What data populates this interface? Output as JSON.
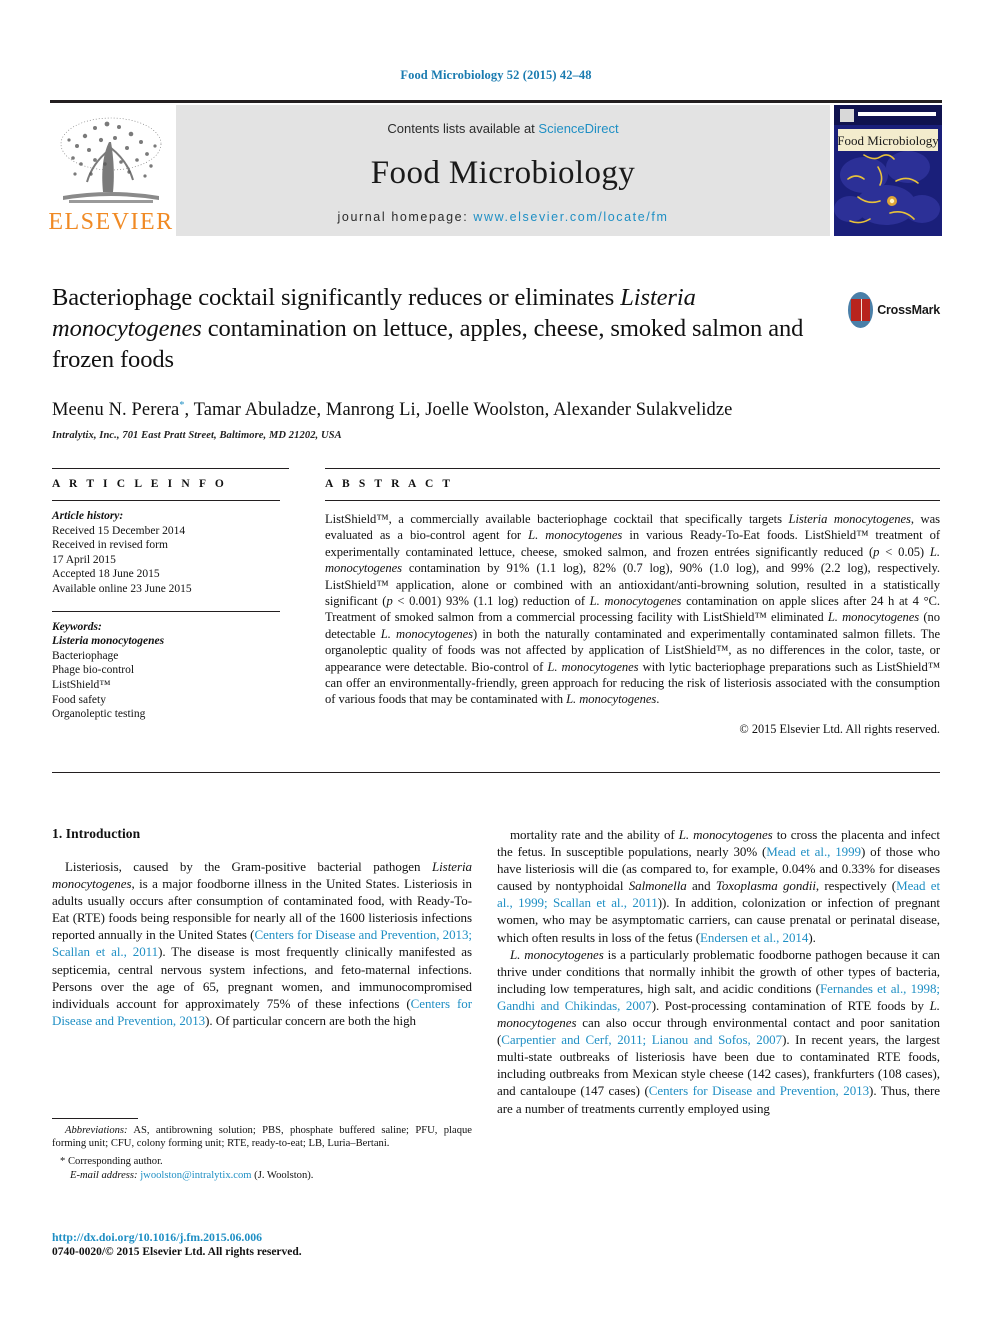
{
  "running_head": "Food Microbiology 52 (2015) 42–48",
  "masthead": {
    "contents_prefix": "Contents lists available at ",
    "sciencedirect": "ScienceDirect",
    "journal_name": "Food Microbiology",
    "homepage_prefix": "journal homepage: ",
    "homepage_url": "www.elsevier.com/locate/fm",
    "publisher_logo_text": "ELSEVIER",
    "cover_title": "Food Microbiology",
    "accent_link_color": "#1f8fc4",
    "elsevier_orange": "#f08a24",
    "panel_gray": "#e3e3e3"
  },
  "crossmark": {
    "label": "CrossMark"
  },
  "article": {
    "title_html": "Bacteriophage cocktail significantly reduces or eliminates <i>Listeria monocytogenes</i> contamination on lettuce, apples, cheese, smoked salmon and frozen foods",
    "title_plain": "Bacteriophage cocktail significantly reduces or eliminates Listeria monocytogenes contamination on lettuce, apples, cheese, smoked salmon and frozen foods",
    "authors_html": "Meenu N. Perera<sup>*</sup>, Tamar Abuladze, Manrong Li, Joelle Woolston, Alexander Sulakvelidze",
    "affiliation": "Intralytix, Inc., 701 East Pratt Street, Baltimore, MD 21202, USA"
  },
  "article_info": {
    "heading": "A R T I C L E   I N F O",
    "history_label": "Article history:",
    "history": [
      "Received 15 December 2014",
      "Received in revised form",
      "17 April 2015",
      "Accepted 18 June 2015",
      "Available online 23 June 2015"
    ],
    "keywords_label": "Keywords:",
    "keywords": [
      "Listeria monocytogenes",
      "Bacteriophage",
      "Phage bio-control",
      "ListShield™",
      "Food safety",
      "Organoleptic testing"
    ]
  },
  "abstract": {
    "heading": "A B S T R A C T",
    "body_html": "ListShield™, a commercially available bacteriophage cocktail that specifically targets <i>Listeria monocytogenes</i>, was evaluated as a bio-control agent for <i>L. monocytogenes</i> in various Ready-To-Eat foods. ListShield™ treatment of experimentally contaminated lettuce, cheese, smoked salmon, and frozen entrées significantly reduced (<i>p</i> &lt; 0.05) <i>L. monocytogenes</i> contamination by 91% (1.1 log), 82% (0.7 log), 90% (1.0 log), and 99% (2.2 log), respectively. ListShield™ application, alone or combined with an antioxidant/anti-browning solution, resulted in a statistically significant (<i>p</i> &lt; 0.001) 93% (1.1 log) reduction of <i>L. monocytogenes</i> contamination on apple slices after 24 h at 4 °C. Treatment of smoked salmon from a commercial processing facility with ListShield™ eliminated <i>L. monocytogenes</i> (no detectable <i>L. monocytogenes</i>) in both the naturally contaminated and experimentally contaminated salmon fillets. The organoleptic quality of foods was not affected by application of ListShield™, as no differences in the color, taste, or appearance were detectable. Bio-control of <i>L. monocytogenes</i> with lytic bacteriophage preparations such as ListShield™ can offer an environmentally-friendly, green approach for reducing the risk of listeriosis associated with the consumption of various foods that may be contaminated with <i>L. monocytogenes</i>.",
    "copyright": "© 2015 Elsevier Ltd. All rights reserved."
  },
  "body": {
    "section_heading": "1. Introduction",
    "left_paragraphs_html": [
      "Listeriosis, caused by the Gram-positive bacterial pathogen <i>Listeria monocytogenes</i>, is a major foodborne illness in the United States. Listeriosis in adults usually occurs after consumption of contaminated food, with Ready-To-Eat (RTE) foods being responsible for nearly all of the 1600 listeriosis infections reported annually in the United States (<span class=\"ref\">Centers for Disease and Prevention, 2013; Scallan et al., 2011</span>). The disease is most frequently clinically manifested as septicemia, central nervous system infections, and feto-maternal infections. Persons over the age of 65, pregnant women, and immunocompromised individuals account for approximately 75% of these infections (<span class=\"ref\">Centers for Disease and Prevention, 2013</span>). Of particular concern are both the high"
    ],
    "right_paragraphs_html": [
      "mortality rate and the ability of <i>L. monocytogenes</i> to cross the placenta and infect the fetus. In susceptible populations, nearly 30% (<span class=\"ref\">Mead et al., 1999</span>) of those who have listeriosis will die (as compared to, for example, 0.04% and 0.33% for diseases caused by nontyphoidal <i>Salmonella</i> and <i>Toxoplasma gondii</i>, respectively (<span class=\"ref\">Mead et al., 1999; Scallan et al., 2011</span>)). In addition, colonization or infection of pregnant women, who may be asymptomatic carriers, can cause prenatal or perinatal disease, which often results in loss of the fetus (<span class=\"ref\">Endersen et al., 2014</span>).",
      "<i>L. monocytogenes</i> is a particularly problematic foodborne pathogen because it can thrive under conditions that normally inhibit the growth of other types of bacteria, including low temperatures, high salt, and acidic conditions (<span class=\"ref\">Fernandes et al., 1998; Gandhi and Chikindas, 2007</span>). Post-processing contamination of RTE foods by <i>L. monocytogenes</i> can also occur through environmental contact and poor sanitation (<span class=\"ref\">Carpentier and Cerf, 2011; Lianou and Sofos, 2007</span>). In recent years, the largest multi-state outbreaks of listeriosis have been due to contaminated RTE foods, including outbreaks from Mexican style cheese (142 cases), frankfurters (108 cases), and cantaloupe (147 cases) (<span class=\"ref\">Centers for Disease and Prevention, 2013</span>). Thus, there are a number of treatments currently employed using"
    ]
  },
  "footnotes": {
    "abbreviations_html": "<i>Abbreviations:</i> AS, antibrowning solution; PBS, phosphate buffered saline; PFU, plaque forming unit; CFU, colony forming unit; RTE, ready-to-eat; LB, Luria–Bertani.",
    "corresponding_author": "Corresponding author.",
    "email_label": "E-mail address:",
    "email": "jwoolston@intralytix.com",
    "email_suffix": "(J. Woolston).",
    "doi": "http://dx.doi.org/10.1016/j.fm.2015.06.006",
    "issn_line": "0740-0020/© 2015 Elsevier Ltd. All rights reserved."
  }
}
